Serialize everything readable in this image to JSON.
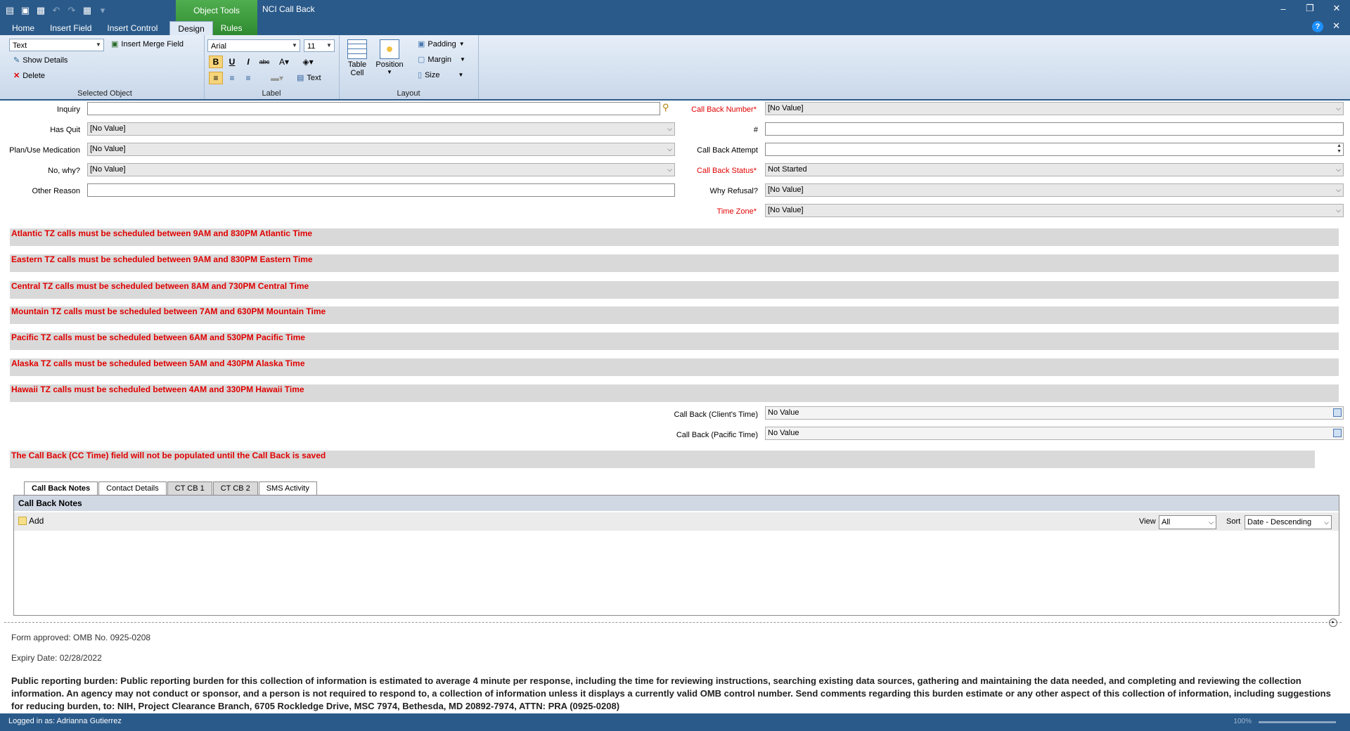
{
  "title_bar": {
    "object_tools": "Object Tools",
    "app_title": "NCI Call Back",
    "win_minimize": "–",
    "win_restore": "❐",
    "win_close": "✕",
    "help": "?",
    "close_doc": "✕"
  },
  "ribbon_tabs": [
    "Home",
    "Insert Field",
    "Insert Control",
    "Design",
    "Rules"
  ],
  "ribbon": {
    "selected_object": {
      "type_value": "Text",
      "insert_merge_field": "Insert Merge Field",
      "show_details": "Show Details",
      "delete": "Delete",
      "group_label": "Selected Object"
    },
    "label": {
      "font": "Arial",
      "size": "11",
      "text_btn": "Text",
      "group_label": "Label"
    },
    "layout": {
      "table_cell": "Table",
      "table_cell2": "Cell",
      "position": "Position",
      "padding": "Padding",
      "margin": "Margin",
      "size": "Size",
      "group_label": "Layout"
    }
  },
  "left_fields": [
    {
      "label": "Inquiry",
      "value": ""
    },
    {
      "label": "Has Quit",
      "value": "[No Value]"
    },
    {
      "label": "Plan/Use Medication",
      "value": "[No Value]"
    },
    {
      "label": "No, why?",
      "value": "[No Value]"
    },
    {
      "label": "Other Reason",
      "value": ""
    }
  ],
  "right_fields": [
    {
      "label": "Call Back Number*",
      "value": "[No Value]"
    },
    {
      "label": "#",
      "value": ""
    },
    {
      "label": "Call Back Attempt",
      "value": ""
    },
    {
      "label": "Call Back Status*",
      "value": "Not Started"
    },
    {
      "label": "Why Refusal?",
      "value": "[No Value]"
    },
    {
      "label": "Time Zone*",
      "value": "[No Value]"
    }
  ],
  "notices": [
    "Atlantic TZ calls must be scheduled between 9AM and 830PM Atlantic Time",
    "Eastern TZ calls must be scheduled between 9AM and 830PM Eastern Time",
    "Central TZ calls must be scheduled between 8AM and 730PM Central Time",
    "Mountain TZ calls must be scheduled between 7AM and 630PM Mountain Time",
    "Pacific TZ calls must be scheduled between 6AM and 530PM Pacific Time",
    "Alaska TZ calls must be scheduled between 5AM and 430PM Alaska Time",
    "Hawaii TZ calls must be scheduled between 4AM and 330PM Hawaii Time"
  ],
  "callback_times": [
    {
      "label": "Call Back (Client's Time)",
      "value": "No Value"
    },
    {
      "label": "Call Back (Pacific Time)",
      "value": "No Value"
    }
  ],
  "cc_notice": "The Call Back (CC Time) field will not be populated until the Call Back is saved",
  "bottom_tabs": [
    "Call Back Notes",
    "Contact Details",
    "CT CB 1",
    "CT CB 2",
    "SMS Activity"
  ],
  "notes_panel": {
    "title": "Call Back Notes",
    "add": "Add",
    "view_label": "View",
    "view_value": "All",
    "sort_label": "Sort",
    "sort_value": "Date - Descending"
  },
  "footer": {
    "form_approved": "Form approved: OMB No. 0925-0208",
    "expiry": "Expiry Date:  02/28/2022",
    "burden": "Public reporting burden: Public reporting burden for this collection of information is estimated to average 4 minute per response, including the time for reviewing instructions, searching existing data sources, gathering and maintaining the data needed, and completing and reviewing the collection information.  An agency may not conduct or sponsor, and a person is not required to respond to, a collection of information unless it displays a currently valid OMB control number.  Send comments regarding this burden estimate or any other aspect of this collection of information, including suggestions for reducing burden, to: NIH, Project Clearance Branch, 6705 Rockledge Drive, MSC 7974, Bethesda, MD 20892-7974, ATTN: PRA (0925-0208)"
  },
  "status_bar": {
    "logged_in": "Logged in as: Adrianna Gutierrez",
    "zoom": "100%"
  }
}
